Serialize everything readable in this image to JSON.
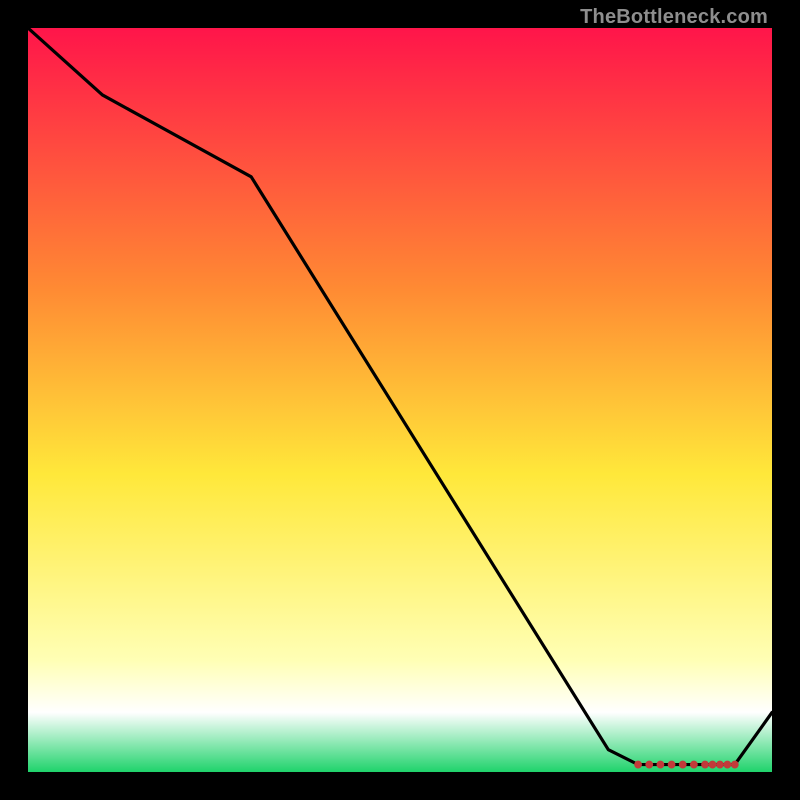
{
  "watermark": "TheBottleneck.com",
  "colors": {
    "bg_black": "#000000",
    "grad_top": "#ff154a",
    "grad_orange": "#ff8a33",
    "grad_yellow": "#ffe83a",
    "grad_paleyellow": "#ffffb5",
    "grad_white": "#ffffff",
    "grad_green": "#1fd36b",
    "line": "#000000",
    "marker_stroke": "#c23a3a",
    "marker_fill": "#c23a3a"
  },
  "chart_data": {
    "type": "line",
    "title": "",
    "xlabel": "",
    "ylabel": "",
    "xlim": [
      0,
      100
    ],
    "ylim": [
      0,
      100
    ],
    "series": [
      {
        "name": "curve",
        "x": [
          0,
          10,
          30,
          78,
          82,
          91,
          95,
          100
        ],
        "y": [
          100,
          91,
          80,
          3,
          1,
          1,
          1,
          8
        ]
      }
    ],
    "markers": {
      "name": "flat-region-markers",
      "x": [
        82,
        83.5,
        85,
        86.5,
        88,
        89.5,
        91,
        92,
        93,
        94,
        95
      ],
      "y": [
        1,
        1,
        1,
        1,
        1,
        1,
        1,
        1,
        1,
        1,
        1
      ]
    },
    "gradient_stops": [
      {
        "offset": 0.0,
        "color": "#ff154a"
      },
      {
        "offset": 0.35,
        "color": "#ff8a33"
      },
      {
        "offset": 0.6,
        "color": "#ffe83a"
      },
      {
        "offset": 0.85,
        "color": "#ffffb5"
      },
      {
        "offset": 0.92,
        "color": "#ffffff"
      },
      {
        "offset": 1.0,
        "color": "#1fd36b"
      }
    ]
  }
}
